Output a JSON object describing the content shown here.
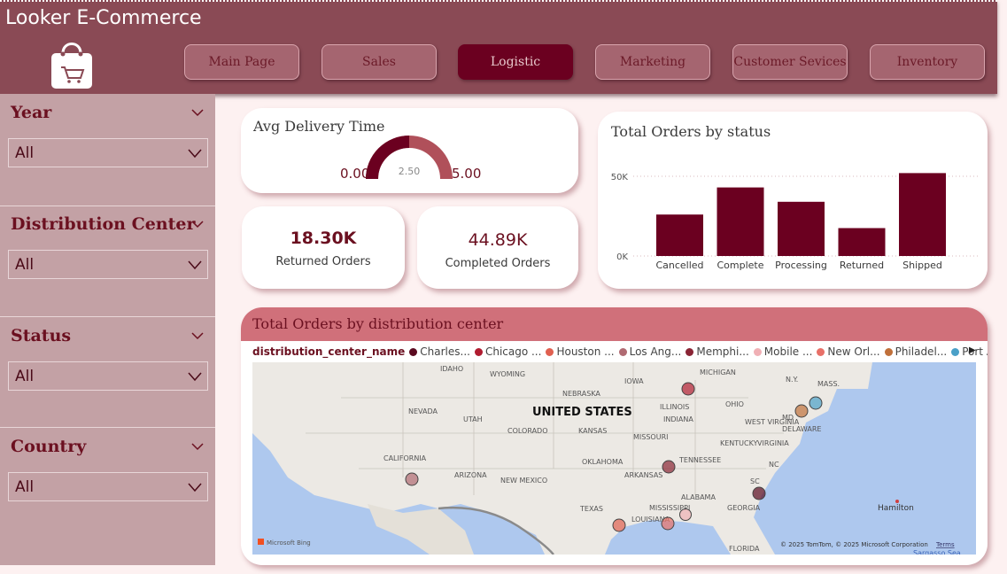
{
  "app": {
    "title": "Looker E-Commerce"
  },
  "nav": [
    {
      "label": "Main Page",
      "active": false
    },
    {
      "label": "Sales",
      "active": false
    },
    {
      "label": "Logistic",
      "active": true
    },
    {
      "label": "Marketing",
      "active": false
    },
    {
      "label": "Customer Sevices",
      "active": false
    },
    {
      "label": "Inventory",
      "active": false
    }
  ],
  "filters": [
    {
      "label": "Year",
      "value": "All"
    },
    {
      "label": "Distribution Center",
      "value": "All"
    },
    {
      "label": "Status",
      "value": "All"
    },
    {
      "label": "Country",
      "value": "All"
    }
  ],
  "gauge": {
    "title": "Avg Delivery Time",
    "min": "0.00",
    "max": "5.00",
    "value_label": "2.50",
    "value": 2.5,
    "range": [
      0,
      5
    ]
  },
  "kpis": [
    {
      "value": "18.30K",
      "label": "Returned Orders"
    },
    {
      "value": "44.89K",
      "label": "Completed Orders"
    }
  ],
  "chart_data": {
    "type": "bar",
    "title": "Total Orders by status",
    "categories": [
      "Cancelled",
      "Complete",
      "Processing",
      "Returned",
      "Shipped"
    ],
    "values": [
      26000,
      43000,
      34000,
      17500,
      52000
    ],
    "yticks": [
      "50K",
      "0K"
    ],
    "ylim": [
      0,
      55000
    ],
    "color": "#6b0020"
  },
  "map": {
    "title": "Total Orders by distribution center",
    "legend_key": "distribution_center_name",
    "legend": [
      {
        "name": "Charles...",
        "color": "#5a0a20"
      },
      {
        "name": "Chicago ...",
        "color": "#b01c30"
      },
      {
        "name": "Houston ...",
        "color": "#e06050"
      },
      {
        "name": "Los Ang...",
        "color": "#b06a72"
      },
      {
        "name": "Memphi...",
        "color": "#8a2535"
      },
      {
        "name": "Mobile ...",
        "color": "#f0b0b5"
      },
      {
        "name": "New Orl...",
        "color": "#e87068"
      },
      {
        "name": "Philadel...",
        "color": "#c0703a"
      },
      {
        "name": "Port Au...",
        "color": "#4aa0c8"
      }
    ],
    "country_label": "UNITED STATES",
    "place_labels": [
      "IDAHO",
      "WYOMING",
      "NEBRASKA",
      "IOWA",
      "MICHIGAN",
      "N.Y.",
      "MASS.",
      "NEVADA",
      "UTAH",
      "ILLINOIS",
      "OHIO",
      "COLORADO",
      "KANSAS",
      "MISSOURI",
      "INDIANA",
      "WEST VIRGINIA",
      "MD",
      "DELAWARE",
      "VIRGINIA",
      "KENTUCKY",
      "CALIFORNIA",
      "OKLAHOMA",
      "TENNESSEE",
      "NC",
      "ARIZONA",
      "NEW MEXICO",
      "ARKANSAS",
      "SC",
      "ALABAMA",
      "MISSISSIPPI",
      "GEORGIA",
      "TEXAS",
      "LOUISIANA",
      "FLORIDA",
      "Hamilton",
      "Sargasso Sea"
    ],
    "attribution": "© 2025 TomTom, © 2025 Microsoft Corporation",
    "terms": "Terms",
    "bing": "Microsoft Bing"
  }
}
